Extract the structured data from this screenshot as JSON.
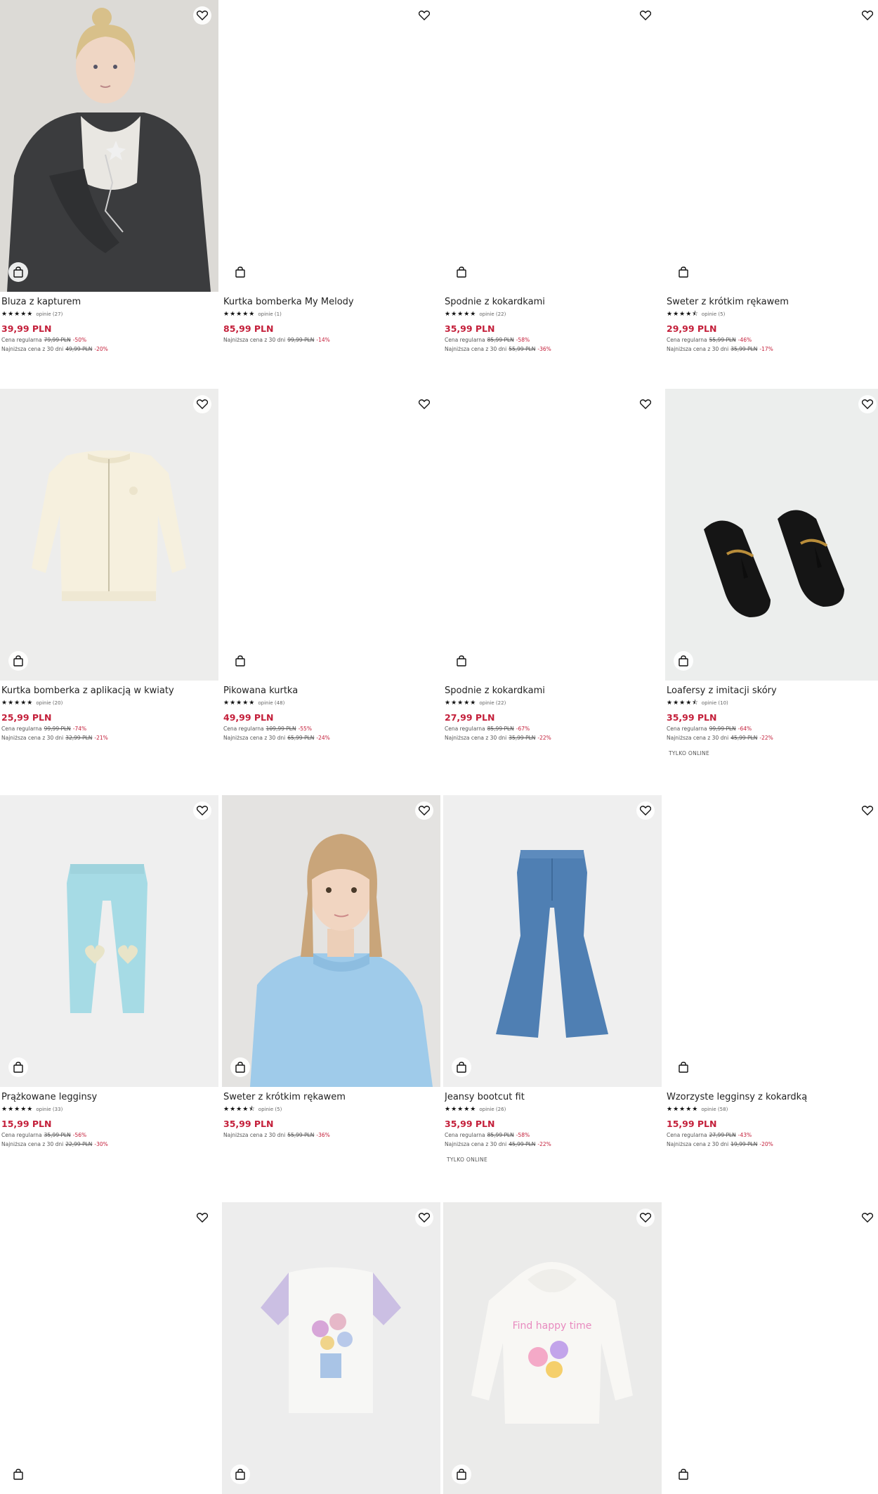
{
  "labels": {
    "regular": "Cena regularna",
    "lowest": "Najniższa cena z 30 dni"
  },
  "colors": {
    "price": "#c4203b",
    "text": "#222222"
  },
  "icons": {
    "favorite": "heart-icon",
    "cart": "shopping-bag-icon"
  },
  "products": [
    {
      "name": "Bluza z kapturem",
      "stars": "★★★★★",
      "reviews": "opinie (27)",
      "price": "39,99 PLN",
      "regular_old": "79,99 PLN",
      "regular_disc": "-50%",
      "lowest_old": "49,99 PLN",
      "lowest_disc": "-20%",
      "badge": "",
      "image": "girl-hoodie"
    },
    {
      "name": "Kurtka bomberka My Melody",
      "stars": "★★★★★",
      "reviews": "opinie (1)",
      "price": "85,99 PLN",
      "regular_old": "",
      "regular_disc": "",
      "lowest_old": "99,99 PLN",
      "lowest_disc": "-14%",
      "badge": "",
      "image": "blank"
    },
    {
      "name": "Spodnie z kokardkami",
      "stars": "★★★★★",
      "reviews": "opinie (22)",
      "price": "35,99 PLN",
      "regular_old": "85,99 PLN",
      "regular_disc": "-58%",
      "lowest_old": "55,99 PLN",
      "lowest_disc": "-36%",
      "badge": "",
      "image": "blank"
    },
    {
      "name": "Sweter z krótkim rękawem",
      "stars": "★★★★⯪",
      "reviews": "opinie (5)",
      "price": "29,99 PLN",
      "regular_old": "55,99 PLN",
      "regular_disc": "-46%",
      "lowest_old": "35,99 PLN",
      "lowest_disc": "-17%",
      "badge": "",
      "image": "blank"
    },
    {
      "name": "Kurtka bomberka z aplikacją w kwiaty",
      "stars": "★★★★★",
      "reviews": "opinie (20)",
      "price": "25,99 PLN",
      "regular_old": "99,99 PLN",
      "regular_disc": "-74%",
      "lowest_old": "32,99 PLN",
      "lowest_disc": "-21%",
      "badge": "",
      "image": "bomber"
    },
    {
      "name": "Pikowana kurtka",
      "stars": "★★★★★",
      "reviews": "opinie (48)",
      "price": "49,99 PLN",
      "regular_old": "109,99 PLN",
      "regular_disc": "-55%",
      "lowest_old": "65,99 PLN",
      "lowest_disc": "-24%",
      "badge": "",
      "image": "blank"
    },
    {
      "name": "Spodnie z kokardkami",
      "stars": "★★★★★",
      "reviews": "opinie (22)",
      "price": "27,99 PLN",
      "regular_old": "85,99 PLN",
      "regular_disc": "-67%",
      "lowest_old": "35,99 PLN",
      "lowest_disc": "-22%",
      "badge": "",
      "image": "blank"
    },
    {
      "name": "Loafersy z imitacji skóry",
      "stars": "★★★★⯪",
      "reviews": "opinie (10)",
      "price": "35,99 PLN",
      "regular_old": "99,99 PLN",
      "regular_disc": "-64%",
      "lowest_old": "45,99 PLN",
      "lowest_disc": "-22%",
      "badge": "TYLKO ONLINE",
      "image": "loafers"
    },
    {
      "name": "Prążkowane legginsy",
      "stars": "★★★★★",
      "reviews": "opinie (33)",
      "price": "15,99 PLN",
      "regular_old": "35,99 PLN",
      "regular_disc": "-56%",
      "lowest_old": "22,99 PLN",
      "lowest_disc": "-30%",
      "badge": "",
      "image": "leggings"
    },
    {
      "name": "Sweter z krótkim rękawem",
      "stars": "★★★★⯪",
      "reviews": "opinie (5)",
      "price": "35,99 PLN",
      "regular_old": "",
      "regular_disc": "",
      "lowest_old": "55,99 PLN",
      "lowest_disc": "-36%",
      "badge": "",
      "image": "girl-sweater"
    },
    {
      "name": "Jeansy bootcut fit",
      "stars": "★★★★★",
      "reviews": "opinie (26)",
      "price": "35,99 PLN",
      "regular_old": "85,99 PLN",
      "regular_disc": "-58%",
      "lowest_old": "45,99 PLN",
      "lowest_disc": "-22%",
      "badge": "TYLKO ONLINE",
      "image": "jeans"
    },
    {
      "name": "Wzorzyste legginsy z kokardką",
      "stars": "★★★★★",
      "reviews": "opinie (58)",
      "price": "15,99 PLN",
      "regular_old": "27,99 PLN",
      "regular_disc": "-43%",
      "lowest_old": "19,99 PLN",
      "lowest_disc": "-20%",
      "badge": "",
      "image": "blank"
    },
    {
      "name": "",
      "stars": "",
      "reviews": "",
      "price": "",
      "regular_old": "",
      "regular_disc": "",
      "lowest_old": "",
      "lowest_disc": "",
      "badge": "",
      "image": "blank"
    },
    {
      "name": "",
      "stars": "",
      "reviews": "",
      "price": "",
      "regular_old": "",
      "regular_disc": "",
      "lowest_old": "",
      "lowest_disc": "",
      "badge": "",
      "image": "tshirt"
    },
    {
      "name": "",
      "stars": "",
      "reviews": "",
      "price": "",
      "regular_old": "",
      "regular_disc": "",
      "lowest_old": "",
      "lowest_disc": "",
      "badge": "",
      "image": "hoodie-white"
    },
    {
      "name": "",
      "stars": "",
      "reviews": "",
      "price": "",
      "regular_old": "",
      "regular_disc": "",
      "lowest_old": "",
      "lowest_disc": "",
      "badge": "",
      "image": "blank"
    }
  ]
}
